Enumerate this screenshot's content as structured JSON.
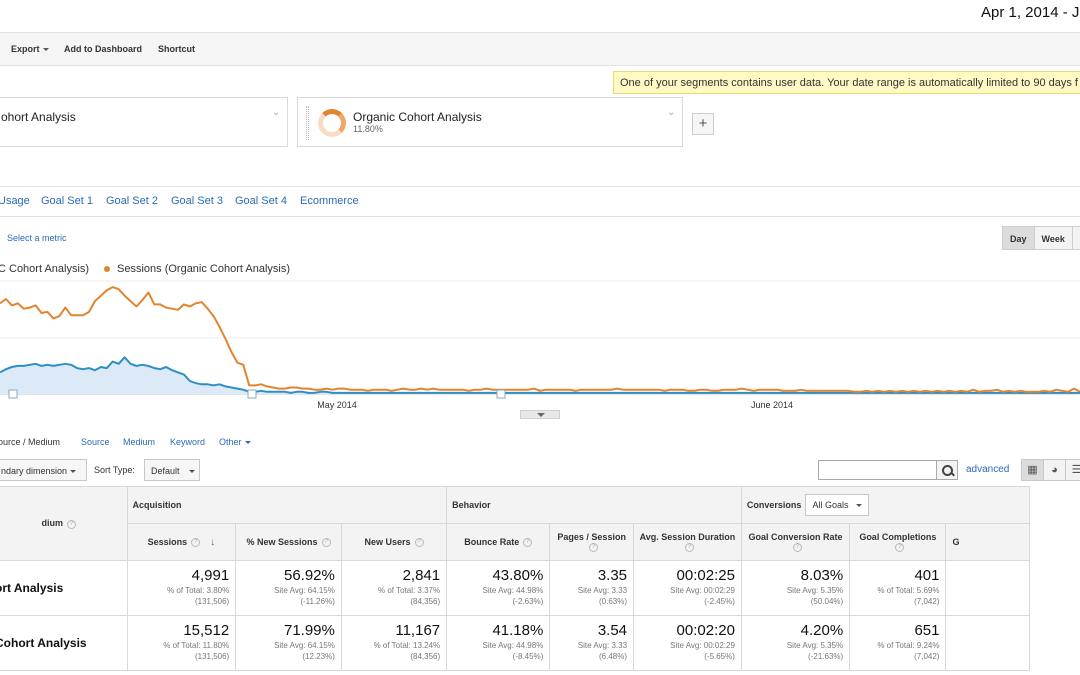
{
  "header": {
    "date_range": "Apr 1, 2014 - Ju"
  },
  "toolbar": {
    "export": "Export",
    "add_dashboard": "Add to Dashboard",
    "shortcut": "Shortcut"
  },
  "notice": "One of your segments contains user data. Your date range is automatically limited to 90 days f",
  "segments": [
    {
      "name": "ohort Analysis"
    },
    {
      "name": "Organic Cohort Analysis",
      "pct": "11.80%"
    }
  ],
  "tabs": [
    "Usage",
    "Goal Set 1",
    "Goal Set 2",
    "Goal Set 3",
    "Goal Set 4",
    "Ecommerce"
  ],
  "chart_controls": {
    "select_metric": "Select a metric",
    "buttons": [
      "Day",
      "Week",
      "M"
    ]
  },
  "legend": [
    "C Cohort Analysis)",
    "Sessions (Organic Cohort Analysis)"
  ],
  "chart_data": {
    "type": "line",
    "title": "",
    "xlabel": "",
    "ylabel": "",
    "x_ticks": [
      "May 2014",
      "June 2014"
    ],
    "series": [
      {
        "name": "Sessions (Organic Cohort Analysis)",
        "color": "#e2842e",
        "values": [
          84,
          88,
          82,
          84,
          79,
          80,
          82,
          75,
          76,
          70,
          72,
          80,
          73,
          73,
          73,
          76,
          86,
          91,
          96,
          99,
          97,
          91,
          86,
          81,
          87,
          94,
          83,
          83,
          80,
          79,
          78,
          83,
          81,
          84,
          85,
          79,
          72,
          62,
          51,
          39,
          29,
          27,
          8,
          8,
          9,
          7,
          6,
          5,
          5,
          6,
          6,
          5,
          5,
          4,
          4,
          5,
          4,
          5,
          5,
          4,
          4,
          4,
          3,
          4,
          4,
          4,
          3,
          4,
          5,
          4,
          4,
          5,
          4,
          5,
          4,
          4,
          4,
          4,
          4,
          3,
          4,
          4,
          5,
          4,
          4,
          4,
          4,
          4,
          4,
          4,
          5,
          3,
          4,
          4,
          4,
          4,
          4,
          3,
          4,
          4,
          4,
          4,
          4,
          4,
          5,
          4,
          4,
          4,
          4,
          4,
          4,
          4,
          3,
          4,
          4,
          4,
          3,
          3,
          4,
          4,
          3,
          3,
          4,
          4,
          4,
          5,
          4,
          3,
          4,
          4,
          4,
          4,
          3,
          3,
          3,
          4,
          3,
          3,
          3,
          3,
          3,
          3,
          3,
          3,
          2,
          2,
          3,
          2,
          3,
          2,
          3,
          2,
          3,
          2,
          3,
          2,
          3,
          2,
          3,
          2,
          3,
          2,
          3,
          2,
          4,
          2,
          3,
          3,
          4,
          2,
          3,
          2,
          3,
          2,
          2,
          2,
          3,
          2,
          4,
          3,
          2,
          5,
          2
        ]
      },
      {
        "name": "C Cohort Analysis)",
        "color": "#2d8fc6",
        "values": [
          20,
          23,
          25,
          26,
          26,
          27,
          28,
          26,
          27,
          26,
          27,
          28,
          27,
          24,
          23,
          24,
          22,
          25,
          24,
          30,
          28,
          34,
          28,
          26,
          27,
          26,
          24,
          23,
          25,
          22,
          20,
          18,
          12,
          10,
          9,
          9,
          8,
          9,
          7,
          6,
          5,
          4,
          2,
          2,
          3,
          2,
          2,
          2,
          2,
          1,
          2,
          2,
          1,
          1,
          2,
          2,
          1,
          1,
          1,
          1,
          1,
          1,
          1,
          1,
          1,
          1,
          1,
          1,
          1,
          1,
          1,
          1,
          1,
          1,
          1,
          1,
          1,
          1,
          1,
          1,
          1,
          1,
          1,
          1,
          1,
          1,
          1,
          1,
          1,
          1,
          1,
          1,
          1,
          1,
          1,
          1,
          1,
          1,
          1,
          1,
          1,
          1,
          1,
          1,
          1,
          1,
          1,
          1,
          1,
          1,
          1,
          1,
          1,
          1,
          1,
          1,
          1,
          1,
          1,
          1,
          1,
          1,
          1,
          1,
          1,
          1,
          1,
          1,
          1,
          1,
          1,
          1,
          1,
          1,
          1,
          1,
          1,
          1,
          1,
          1,
          1,
          1,
          1,
          1,
          1,
          1,
          1,
          1,
          1,
          1,
          1,
          1,
          1,
          1,
          1,
          1,
          1,
          1,
          1,
          1,
          1,
          1,
          1,
          1,
          1,
          1,
          1,
          1,
          1,
          1,
          1,
          1,
          1,
          1,
          1,
          1,
          1,
          1,
          1,
          1,
          1,
          1,
          1
        ]
      }
    ]
  },
  "dimensions": {
    "primary": "ource / Medium",
    "options": [
      "Source",
      "Medium",
      "Keyword",
      "Other"
    ]
  },
  "controls": {
    "secondary": "ndary dimension",
    "sort_label": "Sort Type:",
    "sort_value": "Default",
    "advanced": "advanced"
  },
  "table": {
    "groups": {
      "acquisition": "Acquisition",
      "behavior": "Behavior",
      "conversions": "Conversions",
      "goals": "All Goals"
    },
    "dim_header": "dium",
    "columns": [
      "Sessions",
      "% New Sessions",
      "New Users",
      "Bounce Rate",
      "Pages / Session",
      "Avg. Session Duration",
      "Goal Conversion Rate",
      "Goal Completions",
      "G"
    ],
    "rows": [
      {
        "label": "ort Analysis",
        "cells": [
          {
            "value": "4,991",
            "sub1": "% of Total: 3.80%",
            "sub2": "(131,506)"
          },
          {
            "value": "56.92%",
            "sub1": "Site Avg: 64.15%",
            "sub2": "(-11.26%)"
          },
          {
            "value": "2,841",
            "sub1": "% of Total: 3.37%",
            "sub2": "(84,356)"
          },
          {
            "value": "43.80%",
            "sub1": "Site Avg: 44.98%",
            "sub2": "(-2.63%)"
          },
          {
            "value": "3.35",
            "sub1": "Site Avg: 3.33",
            "sub2": "(0.63%)"
          },
          {
            "value": "00:02:25",
            "sub1": "Site Avg: 00:02:29",
            "sub2": "(-2.45%)"
          },
          {
            "value": "8.03%",
            "sub1": "Site Avg: 5.35%",
            "sub2": "(50.04%)"
          },
          {
            "value": "401",
            "sub1": "% of Total: 5.69%",
            "sub2": "(7,042)"
          }
        ]
      },
      {
        "label": "Cohort Analysis",
        "cells": [
          {
            "value": "15,512",
            "sub1": "% of Total: 11.80%",
            "sub2": "(131,506)"
          },
          {
            "value": "71.99%",
            "sub1": "Site Avg: 64.15%",
            "sub2": "(12.23%)"
          },
          {
            "value": "11,167",
            "sub1": "% of Total: 13.24%",
            "sub2": "(84,356)"
          },
          {
            "value": "41.18%",
            "sub1": "Site Avg: 44.98%",
            "sub2": "(-8.45%)"
          },
          {
            "value": "3.54",
            "sub1": "Site Avg: 3.33",
            "sub2": "(6.48%)"
          },
          {
            "value": "00:02:20",
            "sub1": "Site Avg: 00:02:29",
            "sub2": "(-5.65%)"
          },
          {
            "value": "4.20%",
            "sub1": "Site Avg: 5.35%",
            "sub2": "(-21.63%)"
          },
          {
            "value": "651",
            "sub1": "% of Total: 9.24%",
            "sub2": "(7,042)"
          }
        ]
      }
    ]
  }
}
